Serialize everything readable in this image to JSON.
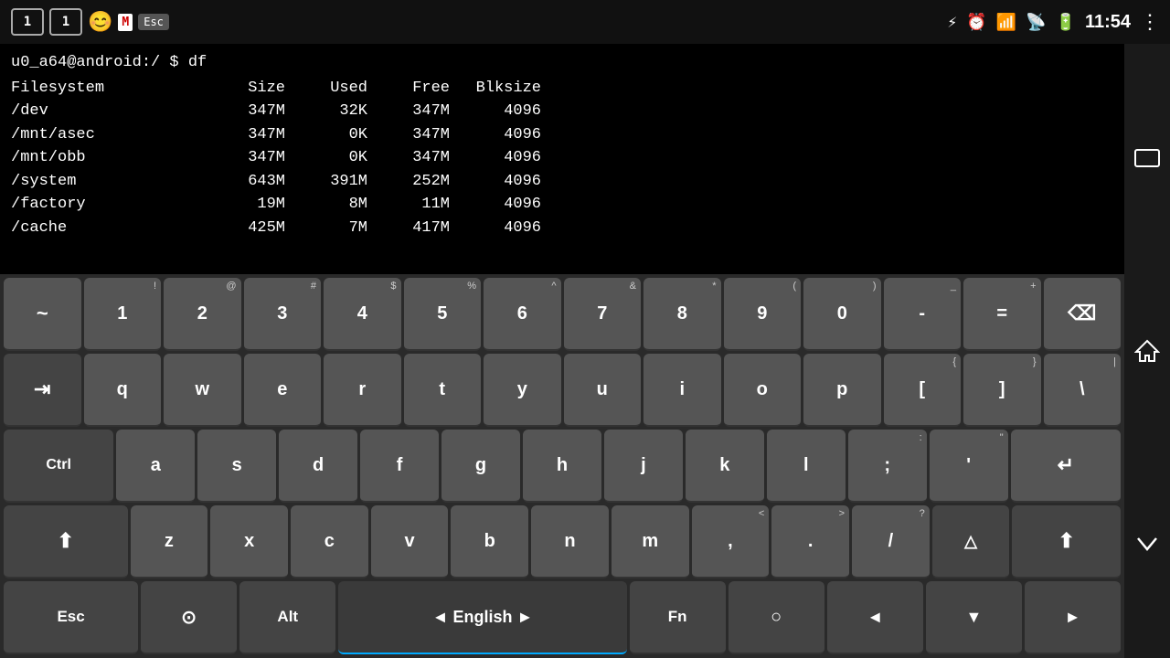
{
  "statusBar": {
    "time": "11:54",
    "leftIcons": [
      "1",
      "1",
      "😊",
      "M",
      "Esc"
    ],
    "rightIcons": [
      "bluetooth",
      "alarm",
      "wifi",
      "signal",
      "battery"
    ]
  },
  "terminal": {
    "prompt": "u0_a64@android:/ $ df",
    "headers": [
      "Filesystem",
      "Size",
      "Used",
      "Free",
      "Blksize"
    ],
    "rows": [
      [
        "/dev",
        "347M",
        "32K",
        "347M",
        "4096"
      ],
      [
        "/mnt/asec",
        "347M",
        "0K",
        "347M",
        "4096"
      ],
      [
        "/mnt/obb",
        "347M",
        "0K",
        "347M",
        "4096"
      ],
      [
        "/system",
        "643M",
        "391M",
        "252M",
        "4096"
      ],
      [
        "/factory",
        "19M",
        "8M",
        "11M",
        "4096"
      ],
      [
        "/cache",
        "425M",
        "7M",
        "417M",
        "4096"
      ]
    ]
  },
  "keyboard": {
    "row1": [
      {
        "label": "~",
        "sup": ""
      },
      {
        "label": "1",
        "sup": "!"
      },
      {
        "label": "2",
        "sup": "@"
      },
      {
        "label": "3",
        "sup": "#"
      },
      {
        "label": "4",
        "sup": "$"
      },
      {
        "label": "5",
        "sup": "%"
      },
      {
        "label": "6",
        "sup": "^"
      },
      {
        "label": "7",
        "sup": "&"
      },
      {
        "label": "8",
        "sup": "*"
      },
      {
        "label": "9",
        "sup": "("
      },
      {
        "label": "0",
        "sup": ")"
      },
      {
        "label": "-",
        "sup": "_"
      },
      {
        "label": "=",
        "sup": "+"
      },
      {
        "label": "⌫",
        "sup": ""
      }
    ],
    "row2": [
      {
        "label": "⇥",
        "sup": ""
      },
      {
        "label": "q",
        "sup": ""
      },
      {
        "label": "w",
        "sup": ""
      },
      {
        "label": "e",
        "sup": ""
      },
      {
        "label": "r",
        "sup": ""
      },
      {
        "label": "t",
        "sup": ""
      },
      {
        "label": "y",
        "sup": ""
      },
      {
        "label": "u",
        "sup": ""
      },
      {
        "label": "i",
        "sup": ""
      },
      {
        "label": "o",
        "sup": ""
      },
      {
        "label": "p",
        "sup": ""
      },
      {
        "label": "[",
        "sup": "{"
      },
      {
        "label": "]",
        "sup": "}"
      },
      {
        "label": "\\",
        "sup": "|"
      }
    ],
    "row3": [
      {
        "label": "Ctrl",
        "sup": ""
      },
      {
        "label": "a",
        "sup": ""
      },
      {
        "label": "s",
        "sup": ""
      },
      {
        "label": "d",
        "sup": ""
      },
      {
        "label": "f",
        "sup": ""
      },
      {
        "label": "g",
        "sup": ""
      },
      {
        "label": "h",
        "sup": ""
      },
      {
        "label": "j",
        "sup": ""
      },
      {
        "label": "k",
        "sup": ""
      },
      {
        "label": "l",
        "sup": ""
      },
      {
        "label": ";",
        "sup": ":"
      },
      {
        "label": "'",
        "sup": "\""
      },
      {
        "label": "↵",
        "sup": ""
      }
    ],
    "row4": [
      {
        "label": "⬆",
        "sup": ""
      },
      {
        "label": "z",
        "sup": ""
      },
      {
        "label": "x",
        "sup": ""
      },
      {
        "label": "c",
        "sup": ""
      },
      {
        "label": "v",
        "sup": ""
      },
      {
        "label": "b",
        "sup": ""
      },
      {
        "label": "n",
        "sup": ""
      },
      {
        "label": "m",
        "sup": ""
      },
      {
        "label": ",",
        "sup": "<"
      },
      {
        "label": ".",
        "sup": ">"
      },
      {
        "label": "/",
        "sup": "?"
      },
      {
        "label": "△",
        "sup": ""
      },
      {
        "label": "⬆",
        "sup": ""
      }
    ],
    "row5": [
      {
        "label": "Esc",
        "sup": ""
      },
      {
        "label": "⊙",
        "sup": ""
      },
      {
        "label": "Alt",
        "sup": ""
      },
      {
        "label": "◄ English ►",
        "sup": ""
      },
      {
        "label": "Fn",
        "sup": ""
      },
      {
        "label": "○",
        "sup": ""
      },
      {
        "label": "◄",
        "sup": ""
      },
      {
        "label": "▼",
        "sup": ""
      },
      {
        "label": "►",
        "sup": ""
      }
    ]
  }
}
